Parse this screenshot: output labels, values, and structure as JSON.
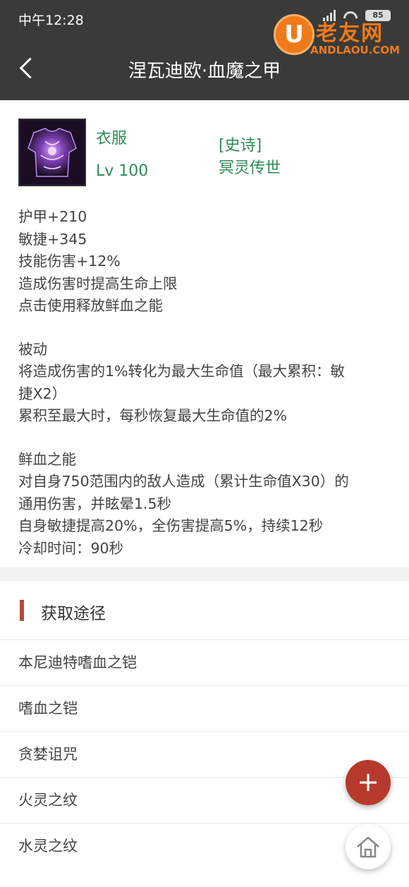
{
  "status_bar": {
    "time": "中午12:28",
    "battery": "85"
  },
  "watermark": {
    "cn": "老友网",
    "en": "ANDLAOU.COM",
    "logo_letter": "U"
  },
  "header": {
    "title": "涅瓦迪欧·血魔之甲",
    "back_icon": "chevron-left-icon"
  },
  "item": {
    "type": "衣服",
    "level": "Lv 100",
    "rarity": "[史诗]",
    "set": "冥灵传世"
  },
  "description": {
    "stats": [
      "护甲+210",
      "敏捷+345",
      "技能伤害+12%",
      "造成伤害时提高生命上限",
      "点击使用释放鲜血之能"
    ],
    "passive": [
      "被动",
      "将造成伤害的1%转化为最大生命值（最大累积：敏",
      "捷X2）",
      "累积至最大时，每秒恢复最大生命值的2%"
    ],
    "active": [
      "鲜血之能",
      "对自身750范围内的敌人造成（累计生命值X30）的",
      "通用伤害，并眩晕1.5秒",
      "自身敏捷提高20%，全伤害提高5%，持续12秒",
      "冷却时间：90秒"
    ]
  },
  "sources": {
    "title": "获取途径",
    "items": [
      "本尼迪特嗜血之铠",
      "嗜血之铠",
      "贪婪诅咒",
      "火灵之纹",
      "水灵之纹"
    ]
  },
  "fab": {
    "add_label": "+",
    "add_icon": "plus-icon",
    "home_icon": "home-icon"
  },
  "colors": {
    "header_bg": "#3a3a3a",
    "accent_green": "#2e8b57",
    "accent_red": "#b5392c"
  }
}
